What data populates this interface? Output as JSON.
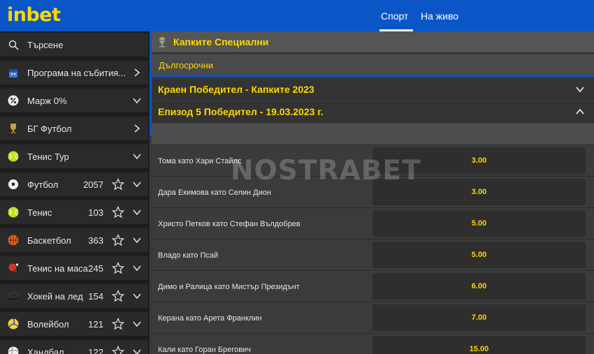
{
  "header": {
    "logo": "inbet",
    "nav": [
      {
        "label": "Спорт"
      },
      {
        "label": "На живо"
      }
    ]
  },
  "sidebar": {
    "items": [
      {
        "label": "Търсене",
        "icon": "search-icon"
      },
      {
        "label": "Програма на събития...",
        "icon": "calendar-icon"
      },
      {
        "label": "Марж 0%",
        "icon": "percent-icon"
      },
      {
        "label": "БГ Футбол",
        "icon": "trophy-icon"
      },
      {
        "label": "Тенис Тур",
        "icon": "tennis-ball-icon"
      },
      {
        "label": "Футбол",
        "count": "2057",
        "icon": "football-icon"
      },
      {
        "label": "Тенис",
        "count": "103",
        "icon": "tennis-ball-icon"
      },
      {
        "label": "Баскетбол",
        "count": "363",
        "icon": "basketball-icon"
      },
      {
        "label": "Тенис на маса",
        "count": "245",
        "icon": "table-tennis-icon"
      },
      {
        "label": "Хокей на лед",
        "count": "154",
        "icon": "hockey-puck-icon"
      },
      {
        "label": "Волейбол",
        "count": "121",
        "icon": "volleyball-icon"
      },
      {
        "label": "Хандбал",
        "count": "122",
        "icon": "handball-icon"
      }
    ]
  },
  "main": {
    "title": "Капките Специални",
    "tab": "Дългосрочни",
    "groups": [
      {
        "title": "Краен Победител - Капките 2023"
      },
      {
        "title": "Епизод 5 Победител - 19.03.2023 г."
      }
    ],
    "selections": [
      {
        "label": "Тома като Хари Стайлс",
        "odds": "3.00"
      },
      {
        "label": "Дара Екимова като Селин Дион",
        "odds": "3.00"
      },
      {
        "label": "Христо Петков като Стефан Вълдобрев",
        "odds": "5.00"
      },
      {
        "label": "Владо като Псай",
        "odds": "5.00"
      },
      {
        "label": "Димо и Ралица като Мистър Президънт",
        "odds": "6.00"
      },
      {
        "label": "Керана като Арета Франклин",
        "odds": "7.00"
      },
      {
        "label": "Кали като Горан Брегович",
        "odds": "15.00"
      }
    ]
  },
  "watermark": "NOSTRABET",
  "colors": {
    "brand_blue": "#0a56c7",
    "accent_yellow": "#ffd800"
  }
}
